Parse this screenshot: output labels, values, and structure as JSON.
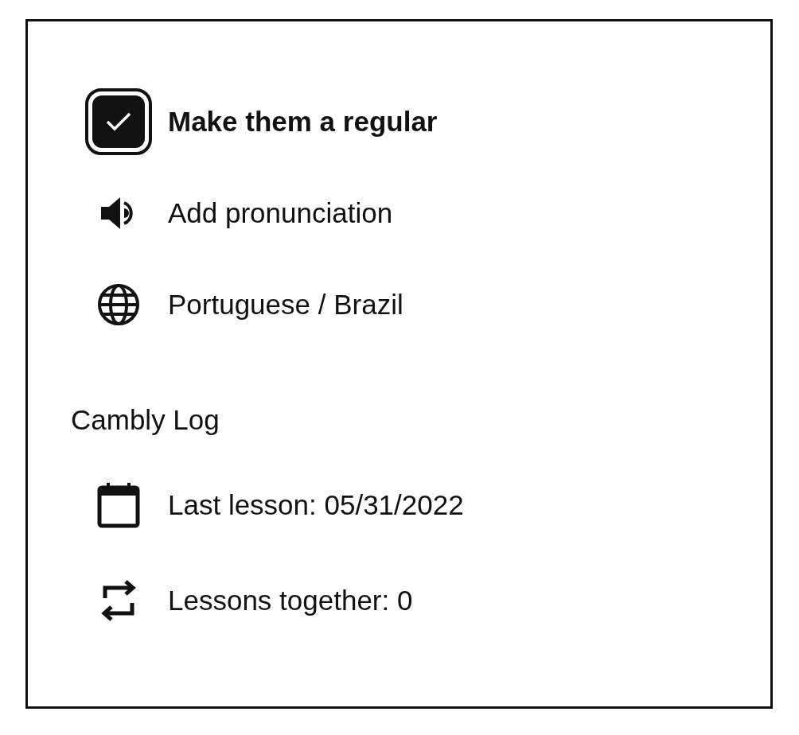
{
  "options": [
    {
      "kind": "checkbox",
      "label": "Make them a regular",
      "checked": true
    },
    {
      "kind": "audio",
      "label": "Add pronunciation"
    },
    {
      "kind": "language",
      "label": "Portuguese / Brazil"
    }
  ],
  "log": {
    "title": "Cambly Log",
    "items": [
      {
        "kind": "calendar",
        "label": "Last lesson: 05/31/2022"
      },
      {
        "kind": "repeat",
        "label": "Lessons together: 0"
      }
    ]
  }
}
